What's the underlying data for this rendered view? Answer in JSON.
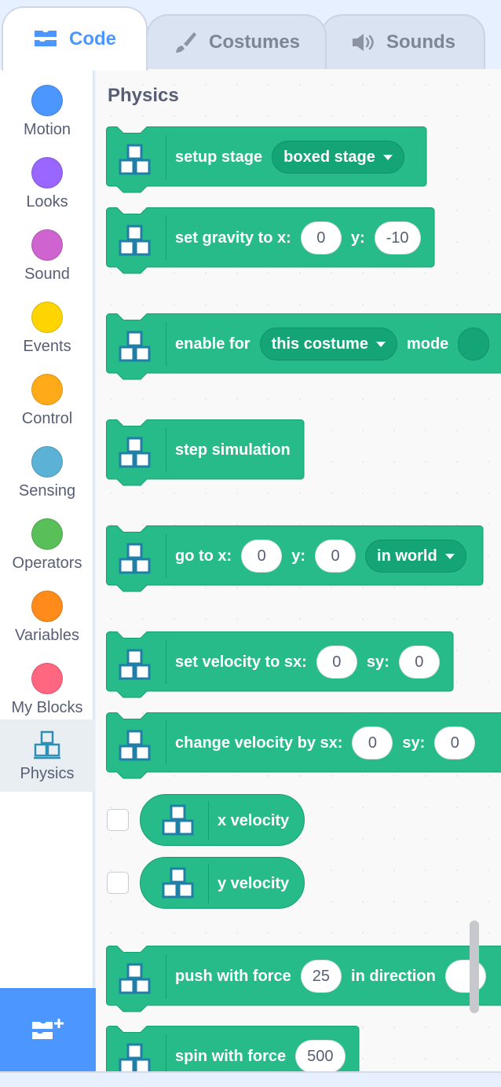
{
  "tabs": [
    {
      "label": "Code",
      "icon": "code-icon",
      "active": true
    },
    {
      "label": "Costumes",
      "icon": "brush-icon",
      "active": false
    },
    {
      "label": "Sounds",
      "icon": "speaker-icon",
      "active": false
    }
  ],
  "categories": [
    {
      "label": "Motion",
      "color": "#4c97ff"
    },
    {
      "label": "Looks",
      "color": "#9966ff"
    },
    {
      "label": "Sound",
      "color": "#cf63cf"
    },
    {
      "label": "Events",
      "color": "#ffd500"
    },
    {
      "label": "Control",
      "color": "#ffab19"
    },
    {
      "label": "Sensing",
      "color": "#5cb1d6"
    },
    {
      "label": "Operators",
      "color": "#59c059"
    },
    {
      "label": "Variables",
      "color": "#ff8c1a"
    },
    {
      "label": "My Blocks",
      "color": "#ff6680"
    },
    {
      "label": "Physics",
      "icon": "physics-icon",
      "selected": true
    }
  ],
  "palette": {
    "title": "Physics",
    "blocks": {
      "setup_stage": {
        "label": "setup stage",
        "dropdown": "boxed stage"
      },
      "set_gravity": {
        "label": "set gravity to x:",
        "x": "0",
        "y_label": "y:",
        "y": "-10"
      },
      "enable_for": {
        "label": "enable for",
        "dropdown": "this costume",
        "mode_label": "mode"
      },
      "step_simulation": {
        "label": "step simulation"
      },
      "go_to": {
        "label": "go to x:",
        "x": "0",
        "y_label": "y:",
        "y": "0",
        "dropdown": "in world"
      },
      "set_velocity": {
        "label": "set velocity to sx:",
        "sx": "0",
        "sy_label": "sy:",
        "sy": "0"
      },
      "change_velocity": {
        "label": "change velocity by sx:",
        "sx": "0",
        "sy_label": "sy:",
        "sy": "0"
      },
      "x_velocity": {
        "label": "x velocity"
      },
      "y_velocity": {
        "label": "y velocity"
      },
      "push_with_force": {
        "label": "push with force",
        "force": "25",
        "dir_label": "in direction"
      },
      "spin_with_force": {
        "label": "spin with force",
        "force": "500"
      }
    }
  },
  "colors": {
    "block_fill": "#27bb89",
    "block_stroke": "#169e73",
    "accent": "#4c97ff"
  }
}
